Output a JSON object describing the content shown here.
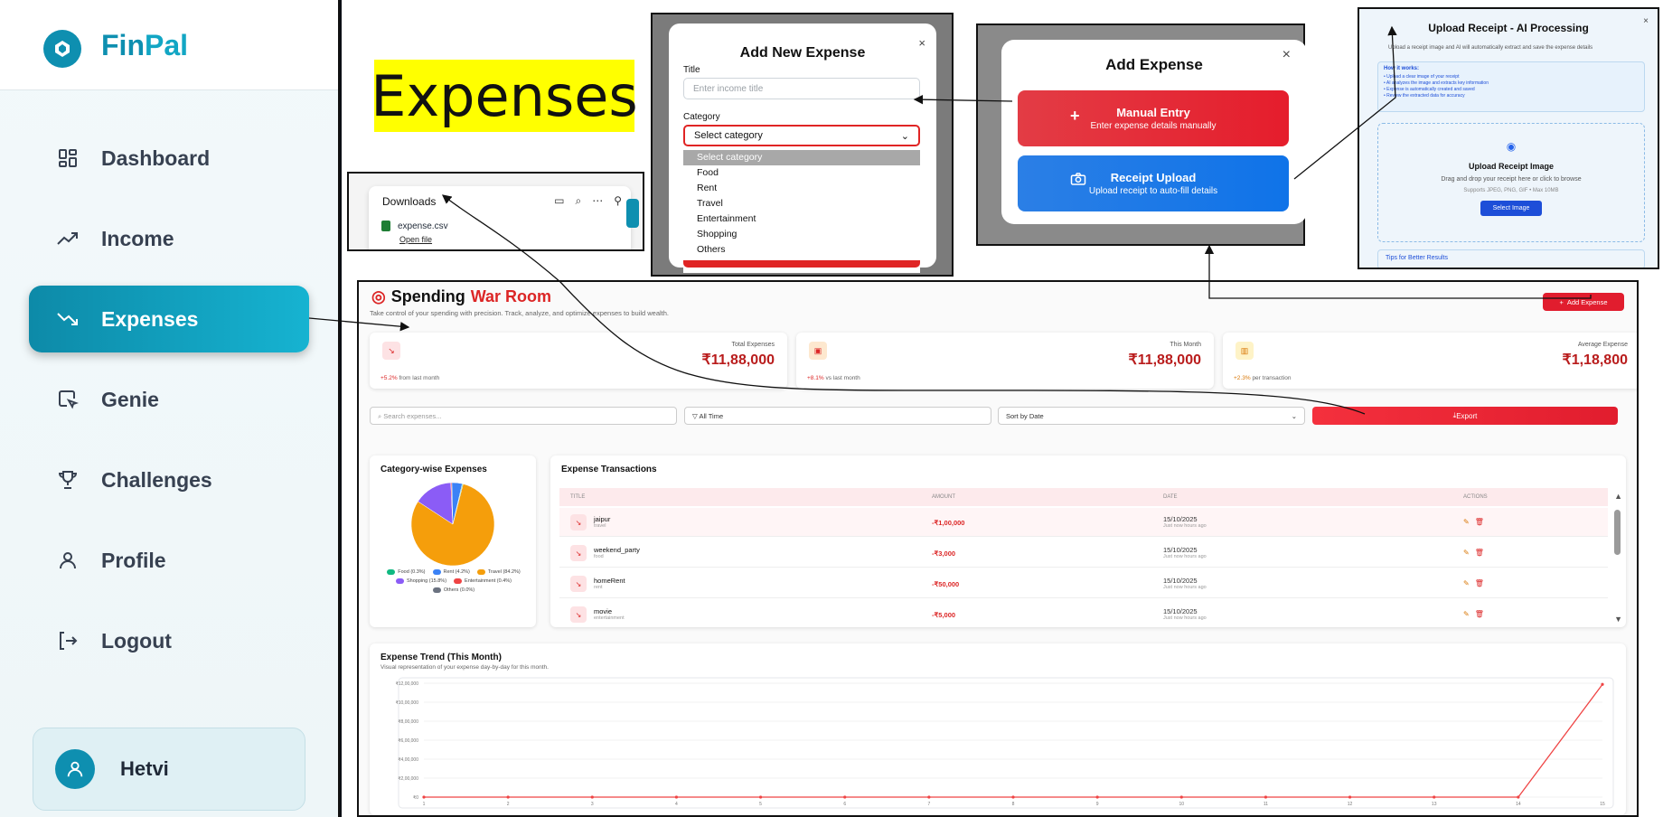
{
  "app": {
    "name_part1": "Fin",
    "name_part2": "Pal"
  },
  "sidebar": {
    "items": [
      {
        "label": "Dashboard",
        "icon": "grid-icon"
      },
      {
        "label": "Income",
        "icon": "trend-up-icon"
      },
      {
        "label": "Expenses",
        "icon": "trend-down-icon",
        "active": true
      },
      {
        "label": "Genie",
        "icon": "cursor-window-icon"
      },
      {
        "label": "Challenges",
        "icon": "trophy-icon"
      },
      {
        "label": "Profile",
        "icon": "user-icon"
      },
      {
        "label": "Logout",
        "icon": "logout-icon"
      }
    ],
    "user": {
      "name": "Hetvi"
    }
  },
  "annotation": {
    "title": "Expenses"
  },
  "downloads": {
    "title": "Downloads",
    "file": "expense.csv",
    "open": "Open file"
  },
  "modal_new_expense": {
    "title": "Add New Expense",
    "close": "×",
    "title_label": "Title",
    "title_placeholder": "Enter income title",
    "category_label": "Category",
    "category_value": "Select category",
    "options": [
      "Select category",
      "Food",
      "Rent",
      "Travel",
      "Entertainment",
      "Shopping",
      "Others"
    ]
  },
  "modal_add_expense": {
    "title": "Add Expense",
    "close": "×",
    "manual_title": "Manual Entry",
    "manual_sub": "Enter expense details manually",
    "receipt_title": "Receipt Upload",
    "receipt_sub": "Upload receipt to auto-fill details"
  },
  "modal_receipt": {
    "title": "Upload Receipt - AI Processing",
    "close": "×",
    "subtitle": "Upload a receipt image and AI will automatically extract and save the expense details",
    "how_title": "How it works:",
    "how_items": [
      "• Upload a clear image of your receipt",
      "• AI analyzes the image and extracts key information",
      "• Expense is automatically created and saved",
      "• Review the extracted data for accuracy"
    ],
    "drop_title": "Upload Receipt Image",
    "drop_sub": "Drag and drop your receipt here or click to browse",
    "drop_formats": "Supports JPEG, PNG, GIF • Max 10MB",
    "select_button": "Select Image",
    "tips": "Tips for Better Results"
  },
  "page": {
    "title_a": "Spending",
    "title_b": "War Room",
    "subtitle": "Take control of your spending with precision. Track, analyze, and optimize expenses to build wealth.",
    "add_button": "Add Expense"
  },
  "stats": [
    {
      "label": "Total Expenses",
      "value": "₹11,88,000",
      "change": "+5.2%",
      "note": "from last month"
    },
    {
      "label": "This Month",
      "value": "₹11,88,000",
      "change": "+8.1%",
      "note": "vs last month"
    },
    {
      "label": "Average Expense",
      "value": "₹1,18,800",
      "change": "+2.3%",
      "note": "per transaction"
    }
  ],
  "filters": {
    "search_placeholder": "Search expenses...",
    "time": "All Time",
    "sort": "Sort by Date",
    "export": "Export"
  },
  "category_card": {
    "title": "Category-wise Expenses",
    "legend": [
      {
        "label": "Food (0.3%)",
        "color": "#10b981"
      },
      {
        "label": "Rent (4.2%)",
        "color": "#3b82f6"
      },
      {
        "label": "Travel (84.2%)",
        "color": "#f59e0b"
      },
      {
        "label": "Shopping (15.8%)",
        "color": "#8b5cf6"
      },
      {
        "label": "Entertainment (0.4%)",
        "color": "#ef4444"
      },
      {
        "label": "Others (0.0%)",
        "color": "#6b7280"
      }
    ]
  },
  "chart_data": [
    {
      "type": "pie",
      "title": "Category-wise Expenses",
      "categories": [
        "Travel",
        "Shopping",
        "Entertainment",
        "Rent",
        "Food",
        "Others"
      ],
      "values": [
        79.5,
        14.9,
        0.4,
        4.0,
        0.3,
        0.0
      ]
    },
    {
      "type": "line",
      "title": "Expense Trend (This Month)",
      "x": [
        1,
        2,
        3,
        4,
        5,
        6,
        7,
        8,
        9,
        10,
        11,
        12,
        13,
        14,
        15
      ],
      "series": [
        {
          "values": [
            0,
            0,
            0,
            0,
            0,
            0,
            0,
            0,
            0,
            0,
            0,
            0,
            0,
            0,
            1188000
          ],
          "color": "#ef4444"
        }
      ],
      "ylim": [
        0,
        1200000
      ],
      "yticks": [
        "₹0",
        "₹2,00,000",
        "₹4,00,000",
        "₹6,00,000",
        "₹8,00,000",
        "₹10,00,000",
        "₹12,00,000"
      ]
    }
  ],
  "transactions": {
    "title": "Expense Transactions",
    "columns": [
      "TITLE",
      "AMOUNT",
      "DATE",
      "ACTIONS"
    ],
    "rows": [
      {
        "title": "jaipur",
        "category": "travel",
        "amount": "-₹1,00,000",
        "date": "15/10/2025",
        "ago": "Just now hours ago"
      },
      {
        "title": "weekend_party",
        "category": "food",
        "amount": "-₹3,000",
        "date": "15/10/2025",
        "ago": "Just now hours ago"
      },
      {
        "title": "homeRent",
        "category": "rent",
        "amount": "-₹50,000",
        "date": "15/10/2025",
        "ago": "Just now hours ago"
      },
      {
        "title": "movie",
        "category": "entertainment",
        "amount": "-₹5,000",
        "date": "15/10/2025",
        "ago": "Just now hours ago"
      }
    ]
  },
  "trend": {
    "title": "Expense Trend (This Month)",
    "subtitle": "Visual representation of your expense day-by-day for this month."
  }
}
